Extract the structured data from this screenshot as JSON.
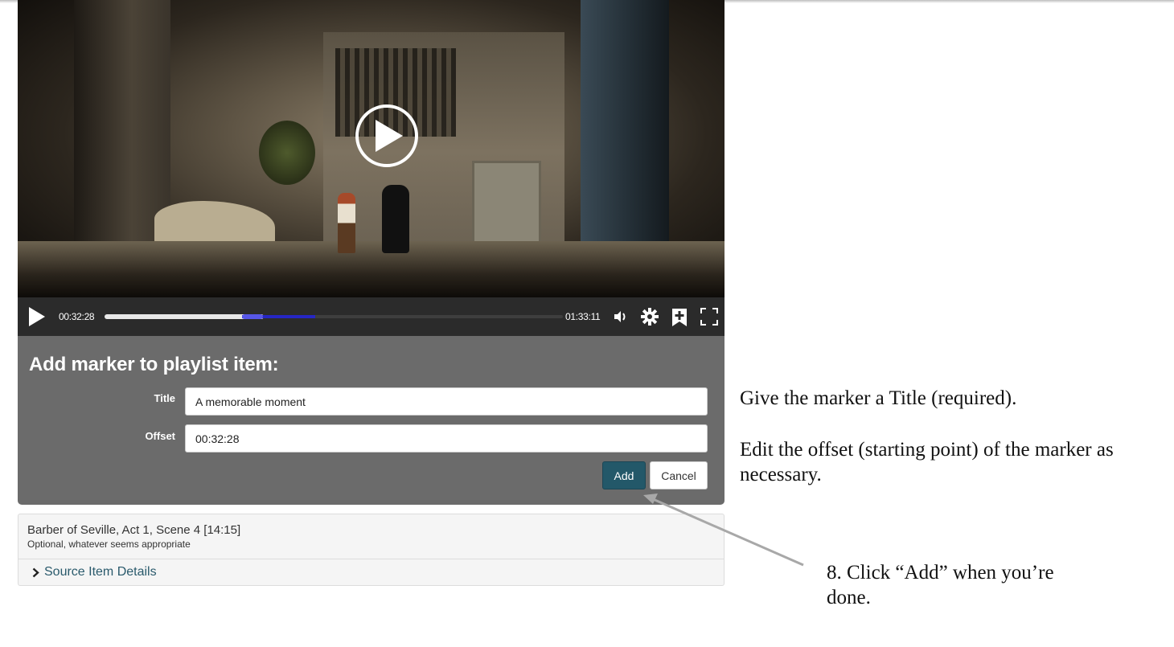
{
  "player": {
    "current_time": "00:32:28",
    "duration": "01:33:11",
    "progress_fraction": 0.347,
    "marker_start_fraction": 0.3,
    "marker_end_fraction": 0.46,
    "icons": [
      "play-icon",
      "volume-icon",
      "gear-icon",
      "add-marker-icon",
      "fullscreen-icon"
    ]
  },
  "marker_form": {
    "heading": "Add marker to playlist item:",
    "title_label": "Title",
    "title_value": "A memorable moment",
    "offset_label": "Offset",
    "offset_value": "00:32:28",
    "add_label": "Add",
    "cancel_label": "Cancel"
  },
  "playlist_item": {
    "title": "Barber of Seville, Act 1, Scene 4 [14:15]",
    "description": "Optional, whatever seems appropriate",
    "details_label": "Source Item Details"
  },
  "instructions": {
    "title_hint": "Give the marker a Title (required).",
    "offset_hint": "Edit the offset (starting point) of the marker as necessary.",
    "step_hint": "8. Click “Add” when you’re done."
  },
  "colors": {
    "panel_bg": "#6b6b6b",
    "add_button": "#235869",
    "link": "#2a5a6c",
    "marker_bar": "#2626c4"
  }
}
